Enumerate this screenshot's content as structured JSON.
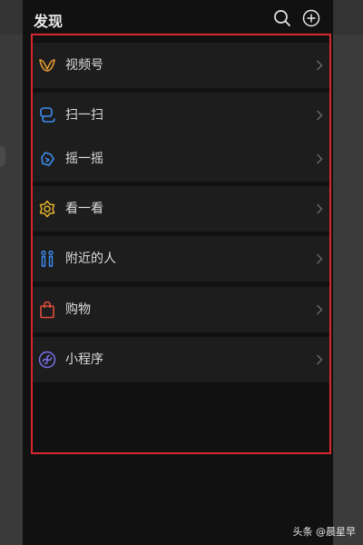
{
  "header": {
    "title": "发现",
    "search_icon": "search-icon",
    "add_icon": "plus-circle-icon"
  },
  "menu": {
    "items": [
      {
        "label": "视频号",
        "icon": "channels-icon",
        "color": "#e69a33"
      },
      {
        "label": "扫一扫",
        "icon": "scan-icon",
        "color": "#3d8cf0"
      },
      {
        "label": "摇一摇",
        "icon": "shake-icon",
        "color": "#3d8cf0"
      },
      {
        "label": "看一看",
        "icon": "top-stories-icon",
        "color": "#e6b42c"
      },
      {
        "label": "附近的人",
        "icon": "people-nearby-icon",
        "color": "#3d8cf0"
      },
      {
        "label": "购物",
        "icon": "shopping-bag-icon",
        "color": "#e24c3c"
      },
      {
        "label": "小程序",
        "icon": "mini-program-icon",
        "color": "#7b6ee8"
      }
    ]
  },
  "highlight_color": "#d9272e",
  "watermark": "头条 @晨星早"
}
